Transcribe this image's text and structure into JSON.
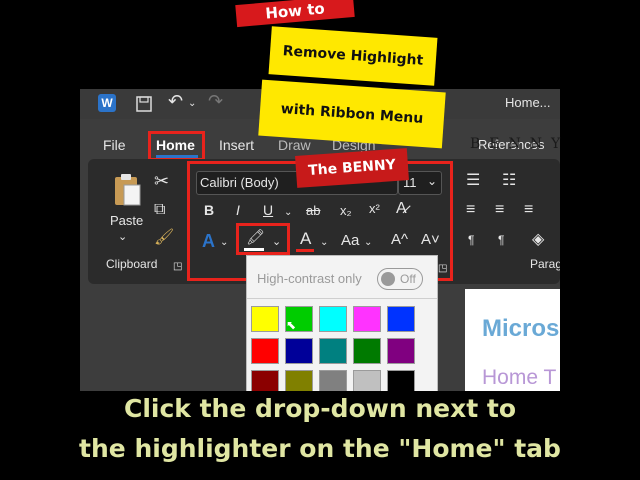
{
  "word": {
    "window_title": "Home...",
    "tabs": [
      {
        "label": "File"
      },
      {
        "label": "Home"
      },
      {
        "label": "Insert"
      },
      {
        "label": "Draw"
      },
      {
        "label": "Design"
      },
      {
        "label": "References"
      }
    ],
    "clipboard": {
      "paste_label": "Paste",
      "group_label": "Clipboard"
    },
    "font": {
      "font_name": "Calibri (Body)",
      "font_size": "11",
      "bold": "B",
      "italic": "I",
      "underline": "U",
      "strikethrough": "ab",
      "subscript": "x₂",
      "superscript": "x²",
      "font_color_letter": "A",
      "text_effects_letter": "A",
      "change_case": "Aa",
      "grow_font": "A^",
      "shrink_font": "A˅"
    },
    "paragraph_group_label": "Parag",
    "highlight_dropdown": {
      "high_contrast_label": "High-contrast only",
      "toggle_label": "Off",
      "colors_row1": [
        "#ffff00",
        "#00cc00",
        "#00ffff",
        "#ff33ff",
        "#0033ff"
      ],
      "colors_row2": [
        "#ff0000",
        "#000099",
        "#008080",
        "#007a00",
        "#800080"
      ],
      "colors_row3": [
        "#8b0000",
        "#808000",
        "#808080",
        "#c0c0c0",
        "#000000"
      ]
    },
    "document": {
      "line1": "Micros",
      "line2": "Home T"
    }
  },
  "banners": {
    "how_to": "How to",
    "remove_highlight": "Remove Highlight",
    "with_ribbon_menu": "with Ribbon Menu",
    "the_benny": "The BENNY",
    "watermark": "BENNY"
  },
  "caption": {
    "line1": "Click the drop-down next to",
    "line2": "the highlighter on the \"Home\" tab"
  },
  "colors": {
    "highlight_red": "#e8231c",
    "banner_yellow": "#ffe800",
    "caption_color": "#e0e6a3",
    "word_blue": "#2b73c9"
  }
}
